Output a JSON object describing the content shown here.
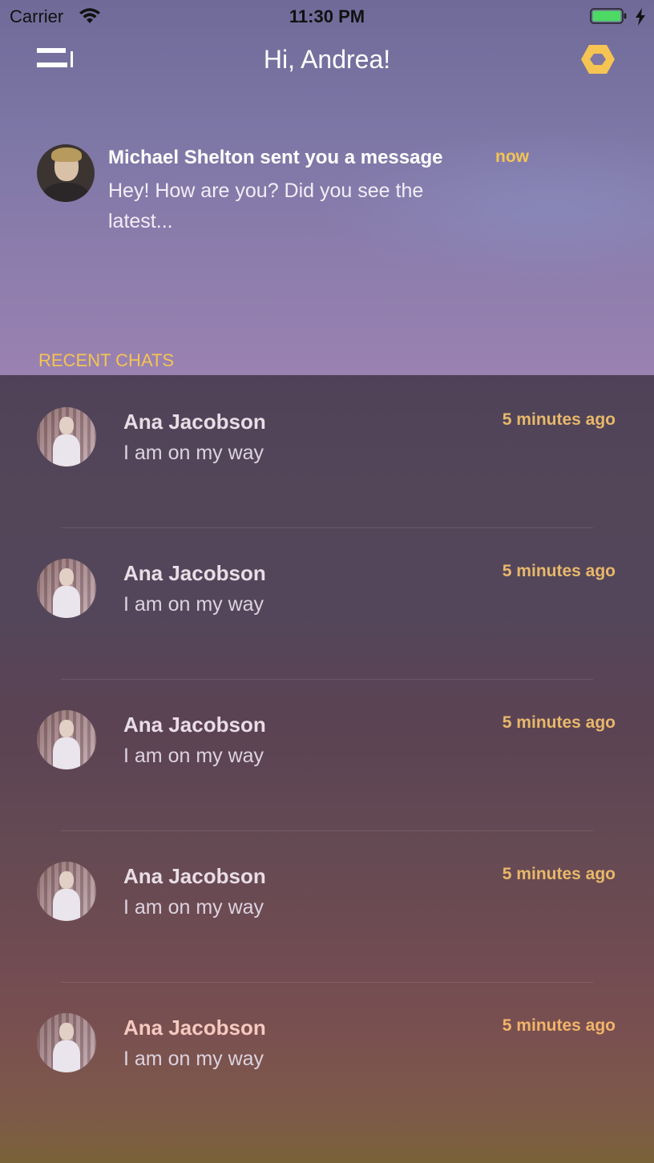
{
  "status_bar": {
    "carrier": "Carrier",
    "time": "11:30 PM",
    "battery_color": "#4cd964"
  },
  "header": {
    "title": "Hi, Andrea!",
    "menu_icon": "menu-icon",
    "action_icon": "hexagon-icon",
    "accent_color": "#f5c453"
  },
  "notification": {
    "title": "Michael Shelton sent you a message",
    "time": "now",
    "body": "Hey! How are you? Did you see the latest..."
  },
  "recent_chats": {
    "label": "RECENT CHATS",
    "items": [
      {
        "name": "Ana Jacobson",
        "message": "I am on my way",
        "time": "5 minutes ago"
      },
      {
        "name": "Ana Jacobson",
        "message": "I am on my way",
        "time": "5 minutes ago"
      },
      {
        "name": "Ana Jacobson",
        "message": "I am on my way",
        "time": "5 minutes ago"
      },
      {
        "name": "Ana Jacobson",
        "message": "I am on my way",
        "time": "5 minutes ago"
      },
      {
        "name": "Ana Jacobson",
        "message": "I am on my way",
        "time": "5 minutes ago"
      }
    ]
  }
}
